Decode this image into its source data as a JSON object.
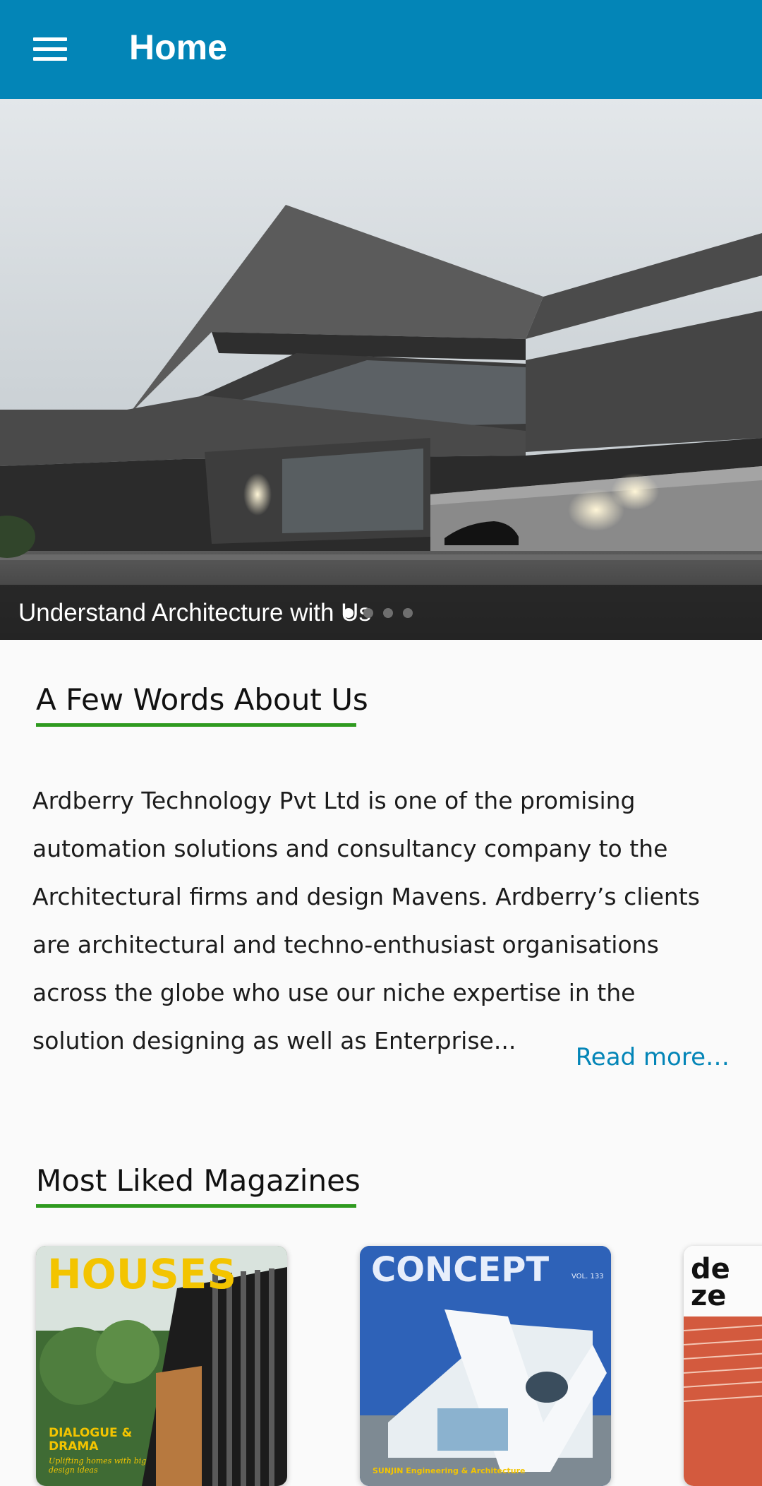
{
  "header": {
    "title": "Home",
    "menu_icon": "hamburger-menu-icon",
    "background": "#0385b7"
  },
  "hero": {
    "caption": "Understand Architecture with Us",
    "slide_count": 4,
    "active_index": 0
  },
  "about": {
    "title": "A Few Words About Us",
    "text": "Ardberry Technology Pvt Ltd is one of the promising automation solutions and consultancy company to the Architectural firms and design Mavens. Ardberry’s clients are architectural and techno-enthusiast organisations across the globe who use our niche expertise in the solution designing as well as Enterprise...",
    "read_more": "Read more…"
  },
  "magazines": {
    "title": "Most Liked Magazines",
    "items": [
      {
        "title": "HOUSES",
        "subtitle": "DIALOGUE & DRAMA",
        "tagline": "Uplifting homes with big design ideas"
      },
      {
        "title": "CONCEPT",
        "volume": "VOL. 133",
        "subtitle": "SUNJIN Engineering & Architecture"
      },
      {
        "title": "de ze"
      }
    ]
  },
  "colors": {
    "accent": "#0385b7",
    "underline": "#2f9a1f"
  }
}
